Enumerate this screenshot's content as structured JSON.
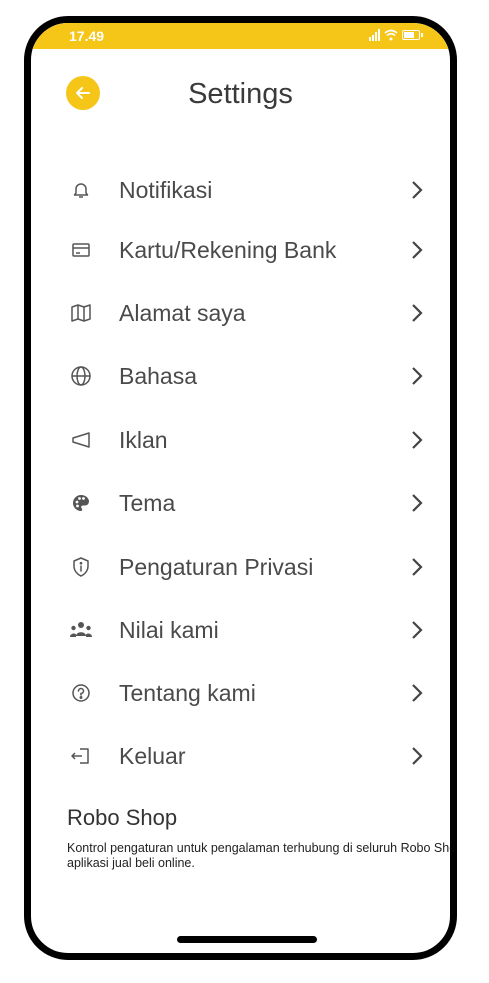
{
  "status_bar": {
    "time": "17.49",
    "color": "#f5c518"
  },
  "header": {
    "title": "Settings",
    "back_icon": "arrow-left-icon",
    "accent": "#f5c518"
  },
  "menu": [
    {
      "label": "Notifikasi",
      "icon": "bell-icon"
    },
    {
      "label": "Kartu/Rekening Bank",
      "icon": "credit-card-icon"
    },
    {
      "label": "Alamat saya",
      "icon": "map-icon"
    },
    {
      "label": "Bahasa",
      "icon": "globe-icon"
    },
    {
      "label": "Iklan",
      "icon": "megaphone-icon"
    },
    {
      "label": "Tema",
      "icon": "palette-icon"
    },
    {
      "label": "Pengaturan Privasi",
      "icon": "shield-info-icon"
    },
    {
      "label": "Nilai kami",
      "icon": "people-icon"
    },
    {
      "label": "Tentang kami",
      "icon": "help-circle-icon"
    },
    {
      "label": "Keluar",
      "icon": "logout-icon"
    }
  ],
  "footer": {
    "title": "Robo Shop",
    "description": "Kontrol pengaturan untuk pengalaman terhubung di seluruh Robo Shop, aplikasi jual beli online."
  }
}
